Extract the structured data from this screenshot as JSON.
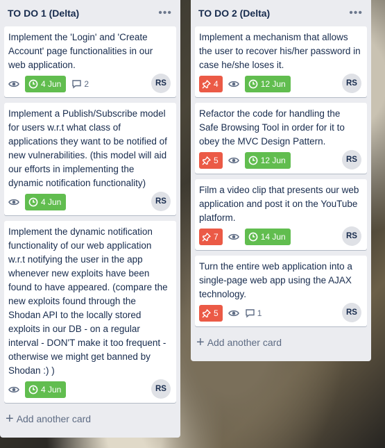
{
  "colors": {
    "list_bg": "#ebecf0",
    "date_badge": "#61bd4f",
    "vote_badge": "#eb5a46",
    "text": "#172b4d",
    "muted": "#5e6c84"
  },
  "lists": [
    {
      "title": "TO DO 1 (Delta)",
      "menu": "•••",
      "add_card_label": "Add another card",
      "cards": [
        {
          "title": "Implement the 'Login' and 'Create Account' page functionalities in our web application.",
          "date": "4 Jun",
          "comments": "2",
          "avatar": "RS"
        },
        {
          "title": "Implement a Publish/Subscribe model for users w.r.t what class of applications they want to be notified of new vulnerabilities. (this model will aid our efforts in implementing the dynamic notification functionality)",
          "date": "4 Jun",
          "avatar": "RS"
        },
        {
          "title": "Implement the dynamic notification functionality of our web application w.r.t notifying the user in the app whenever new exploits have been found to have appeared. (compare the new exploits found through the Shodan API to the locally stored exploits in our DB - on a regular interval - DON'T make it too frequent - otherwise we might get banned by Shodan :) )",
          "date": "4 Jun",
          "avatar": "RS"
        }
      ]
    },
    {
      "title": "TO DO 2 (Delta)",
      "menu": "•••",
      "add_card_label": "Add another card",
      "cards": [
        {
          "title": "Implement a mechanism that allows the user to recover his/her password in case he/she loses it.",
          "votes": "4",
          "date": "12 Jun",
          "avatar": "RS"
        },
        {
          "title": "Refactor the code for handling the Safe Browsing Tool in order for it to obey the MVC Design Pattern.",
          "votes": "5",
          "date": "12 Jun",
          "avatar": "RS"
        },
        {
          "title": "Film a video clip that presents our web application and post it on the YouTube platform.",
          "votes": "7",
          "date": "14 Jun",
          "avatar": "RS"
        },
        {
          "title": "Turn the entire web application into a single-page web app using the AJAX technology.",
          "votes": "5",
          "comments": "1",
          "avatar": "RS"
        }
      ]
    }
  ]
}
